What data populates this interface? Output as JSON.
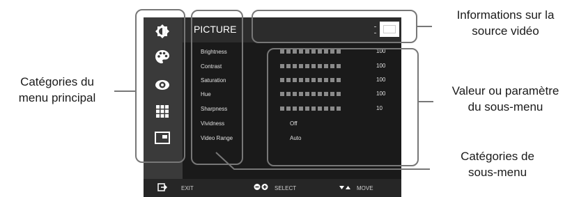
{
  "osd": {
    "title": "PICTURE",
    "categories": [
      {
        "icon": "brightness-contrast-icon"
      },
      {
        "icon": "color-palette-icon"
      },
      {
        "icon": "eye-icon"
      },
      {
        "icon": "grid-icon"
      },
      {
        "icon": "picture-in-picture-icon"
      }
    ],
    "submenu": [
      {
        "label": "Brightness",
        "value": "100",
        "type": "bar"
      },
      {
        "label": "Contrast",
        "value": "100",
        "type": "bar"
      },
      {
        "label": "Saturation",
        "value": "100",
        "type": "bar"
      },
      {
        "label": "Hue",
        "value": "100",
        "type": "bar"
      },
      {
        "label": "Sharpness",
        "value": "10",
        "type": "bar"
      },
      {
        "label": "Vividness",
        "value": "Off",
        "type": "option"
      },
      {
        "label": "Video Range",
        "value": "Auto",
        "type": "option"
      }
    ],
    "footer": {
      "exit": "EXIT",
      "select": "SELECT",
      "move": "MOVE"
    }
  },
  "annotations": {
    "main_categories": {
      "line1": "Catégories du",
      "line2": "menu principal"
    },
    "source_info": {
      "line1": "Informations sur la",
      "line2": "source vidéo"
    },
    "submenu_value": {
      "line1": "Valeur ou paramètre",
      "line2": "du sous-menu"
    },
    "submenu_categories": {
      "line1": "Catégories de",
      "line2": "sous-menu"
    }
  },
  "colors": {
    "osd_background": "#1a1a1a",
    "icon_column": "#3a3a3a",
    "callout_stroke": "#777777"
  }
}
